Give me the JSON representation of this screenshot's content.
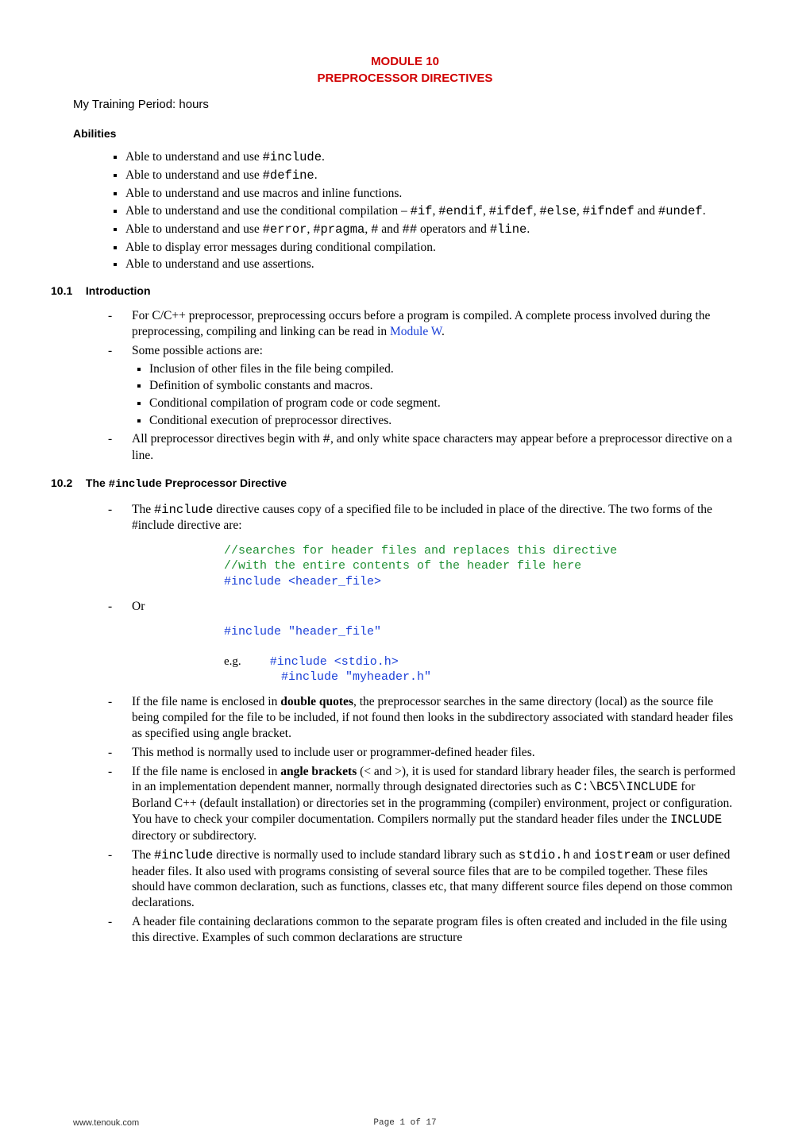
{
  "header": {
    "line1": "MODULE 10",
    "line2": "PREPROCESSOR DIRECTIVES"
  },
  "training_line": "My Training Period:        hours",
  "abilities": {
    "heading": "Abilities",
    "items": [
      [
        {
          "t": "Able to understand and use "
        },
        {
          "t": "#include",
          "mono": true
        },
        {
          "t": "."
        }
      ],
      [
        {
          "t": "Able to understand and use "
        },
        {
          "t": "#define",
          "mono": true
        },
        {
          "t": "."
        }
      ],
      [
        {
          "t": "Able to understand and use macros and inline functions."
        }
      ],
      [
        {
          "t": "Able to understand and use the conditional compilation – "
        },
        {
          "t": "#if",
          "mono": true
        },
        {
          "t": ", "
        },
        {
          "t": "#endif",
          "mono": true
        },
        {
          "t": ", "
        },
        {
          "t": "#ifdef",
          "mono": true
        },
        {
          "t": ", "
        },
        {
          "t": "#else",
          "mono": true
        },
        {
          "t": ", "
        },
        {
          "t": "#ifndef",
          "mono": true
        },
        {
          "t": " and "
        },
        {
          "t": "#undef",
          "mono": true
        },
        {
          "t": "."
        }
      ],
      [
        {
          "t": "Able to understand and use "
        },
        {
          "t": "#error",
          "mono": true
        },
        {
          "t": ", "
        },
        {
          "t": "#pragma",
          "mono": true
        },
        {
          "t": ", "
        },
        {
          "t": "#",
          "mono": true
        },
        {
          "t": " and "
        },
        {
          "t": "##",
          "mono": true
        },
        {
          "t": " operators and "
        },
        {
          "t": "#line",
          "mono": true
        },
        {
          "t": "."
        }
      ],
      [
        {
          "t": "Able to display error messages during conditional compilation."
        }
      ],
      [
        {
          "t": "Able to understand and use assertions."
        }
      ]
    ]
  },
  "s101": {
    "num": "10.1",
    "title": "Introduction",
    "outer": [
      [
        {
          "t": "For C/C++ preprocessor, preprocessing occurs before a program is compiled.  A complete process involved during the preprocessing, compiling and linking can be read in "
        },
        {
          "t": "Module W",
          "blue": true
        },
        {
          "t": "."
        }
      ],
      [
        {
          "t": "Some possible actions are:"
        }
      ]
    ],
    "inner": [
      "Inclusion of other files in the file being compiled.",
      "Definition of symbolic constants and macros.",
      "Conditional compilation of program code or code segment.",
      "Conditional execution of preprocessor directives."
    ],
    "after": [
      [
        {
          "t": "All preprocessor directives begin with "
        },
        {
          "t": "#",
          "mono": true
        },
        {
          "t": ", and only white space characters may appear before a preprocessor directive on a line."
        }
      ]
    ]
  },
  "s102": {
    "num": "10.2",
    "title_pre": "The ",
    "title_code": "#include",
    "title_post": " Preprocessor Directive",
    "lead": [
      [
        {
          "t": "The "
        },
        {
          "t": "#include",
          "mono": true
        },
        {
          "t": " directive causes copy of a specified file to be included in place of the directive.  The two forms of the #include directive are:"
        }
      ]
    ],
    "code1": {
      "c1": "//searches for header files and replaces this directive",
      "c2": "//with the entire contents of the header file here",
      "c3": "#include <header_file>"
    },
    "or": "Or",
    "code2": {
      "l1": "#include \"header_file\"",
      "eg": "e.g.",
      "l2": "#include <stdio.h>",
      "l3": "#include \"myheader.h\""
    },
    "tail": [
      [
        {
          "t": "If the file name is enclosed in "
        },
        {
          "t": "double quotes",
          "bold": true
        },
        {
          "t": ", the preprocessor searches in the same directory (local) as the source file being compiled for the file to be included, if not found then looks in the subdirectory associated with standard header files as specified using angle bracket."
        }
      ],
      [
        {
          "t": "This method is normally used to include user or programmer-defined header files."
        }
      ],
      [
        {
          "t": "If the file name is enclosed in "
        },
        {
          "t": "angle brackets",
          "bold": true
        },
        {
          "t": " (< and >), it is used for standard library header files, the search is performed in an implementation dependent manner, normally through designated directories such as "
        },
        {
          "t": "C:\\BC5\\INCLUDE",
          "mono": true
        },
        {
          "t": " for Borland C++ (default installation) or directories set in the programming (compiler) environment, project or configuration.  You have to check your compiler documentation.  Compilers normally put the standard header files under the "
        },
        {
          "t": "INCLUDE",
          "mono": true
        },
        {
          "t": " directory or subdirectory."
        }
      ],
      [
        {
          "t": "The "
        },
        {
          "t": "#include",
          "mono": true
        },
        {
          "t": " directive is normally used to include standard library such as "
        },
        {
          "t": "stdio.h",
          "mono": true
        },
        {
          "t": " and "
        },
        {
          "t": "iostream",
          "mono": true
        },
        {
          "t": " or user defined header files.  It also used with programs consisting of several source files that are to be compiled together. These files should have common declaration, such as functions, classes etc, that many different source files depend on those common declarations."
        }
      ],
      [
        {
          "t": "A header file containing declarations common to the separate program files is often created and included in the file using this directive.  Examples of such common declarations are structure"
        }
      ]
    ]
  },
  "footer": {
    "site": "www.tenouk.com",
    "page": "Page 1 of 17"
  }
}
